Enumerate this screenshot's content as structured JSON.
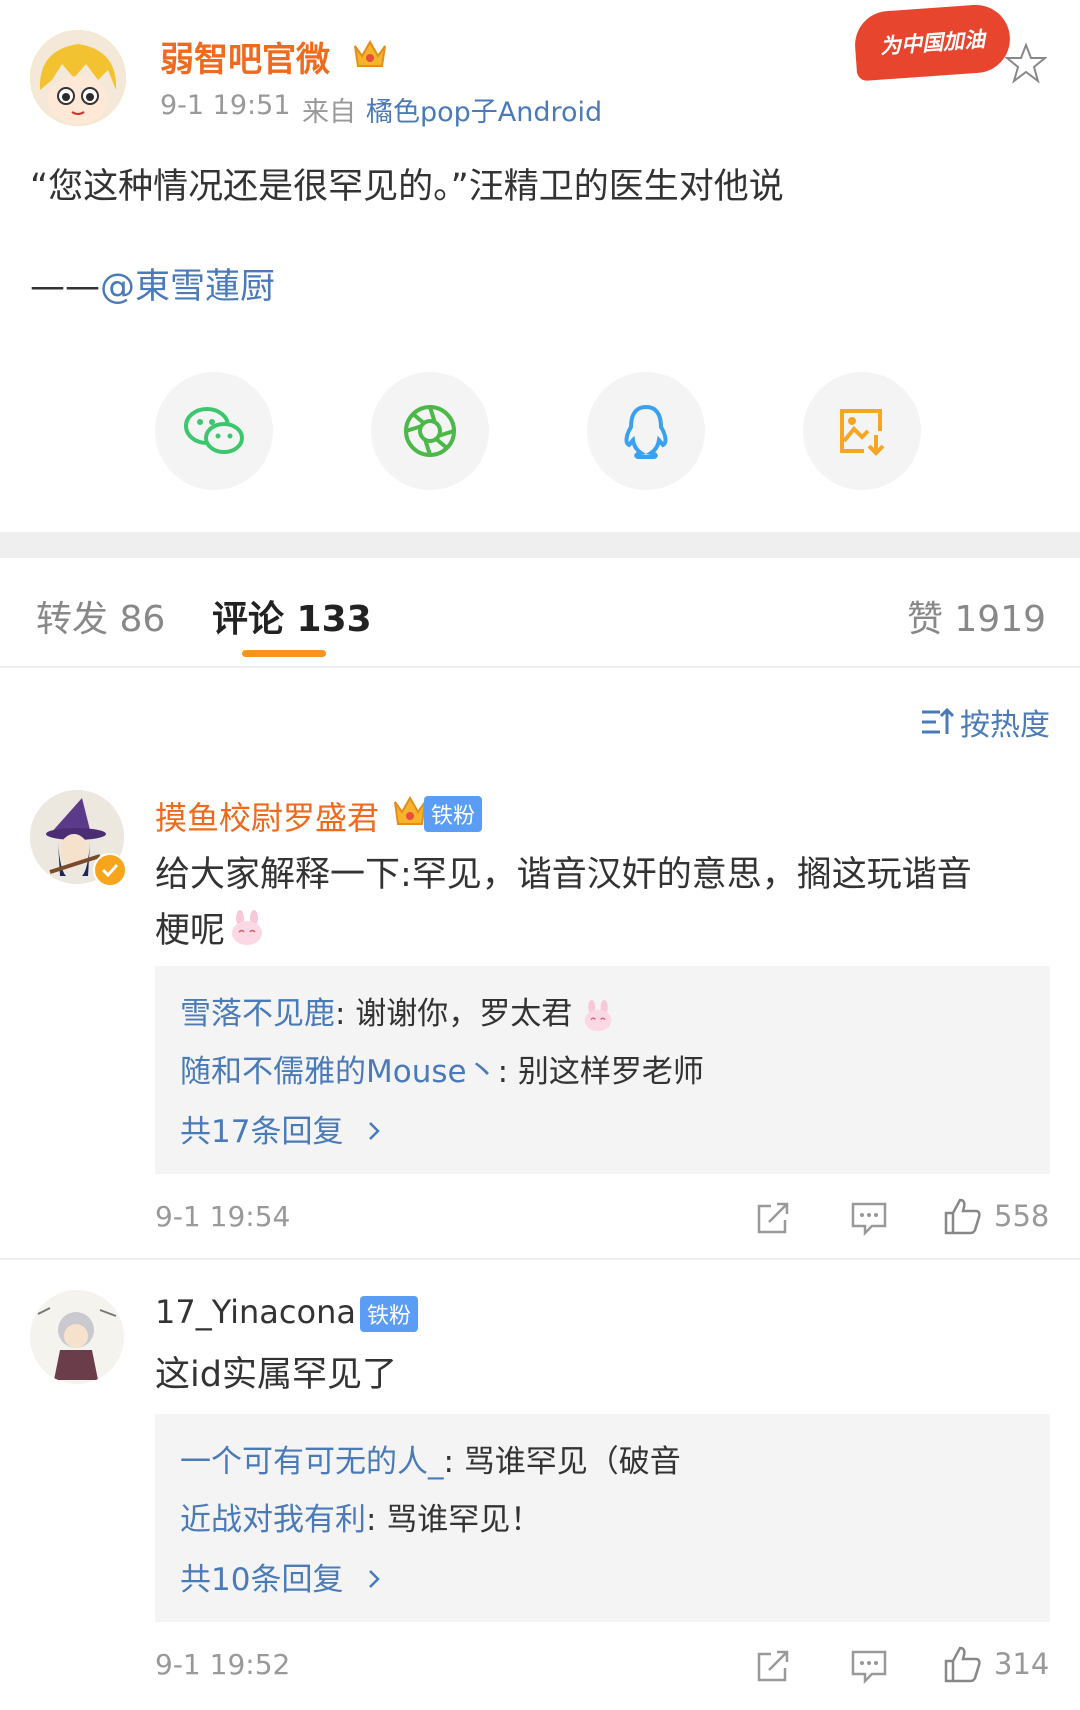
{
  "post": {
    "author": "弱智吧官微",
    "time": "9-1 19:51",
    "source_prefix": "来自",
    "source": "橘色pop子Android",
    "promo_badge": "为中国加油",
    "content_line1": "“您这种情况还是很罕见的。”汪精卫的医生对他说",
    "content_dash": "——",
    "content_mention": "@東雪蓮厨"
  },
  "share": {
    "items": [
      {
        "icon": "wechat-icon"
      },
      {
        "icon": "moments-icon"
      },
      {
        "icon": "qq-icon"
      },
      {
        "icon": "save-image-icon"
      }
    ]
  },
  "tabs": {
    "repost": "转发 86",
    "comment": "评论 133",
    "like": "赞 1919"
  },
  "sort": {
    "label": "按热度"
  },
  "comments": [
    {
      "author": "摸鱼校尉罗盛君",
      "badge": "铁粉",
      "text_line1": "给大家解释一下:罕见，谐音汉奸的意思，搁这玩谐音",
      "text_line2": "梗呢",
      "replies": [
        {
          "user": "雪落不见鹿",
          "text": ": 谢谢你，罗太君"
        },
        {
          "user": "随和不儒雅的Mouse丶",
          "text": ": 别这样罗老师"
        }
      ],
      "more": "共17条回复",
      "time": "9-1 19:54",
      "likes": "558"
    },
    {
      "author": "17_Yinacona",
      "badge": "铁粉",
      "text_line1": "这id实属罕见了",
      "replies": [
        {
          "user": "一个可有可无的人_",
          "text": ": 骂谁罕见（破音"
        },
        {
          "user": "近战对我有利",
          "text": ": 骂谁罕见！"
        }
      ],
      "more": "共10条回复",
      "time": "9-1 19:52",
      "likes": "314"
    }
  ],
  "colors": {
    "accent_orange": "#f06a1d",
    "link_blue": "#4a7bb8",
    "tab_underline": "#f7931e",
    "badge_blue": "#5b9cf5"
  }
}
